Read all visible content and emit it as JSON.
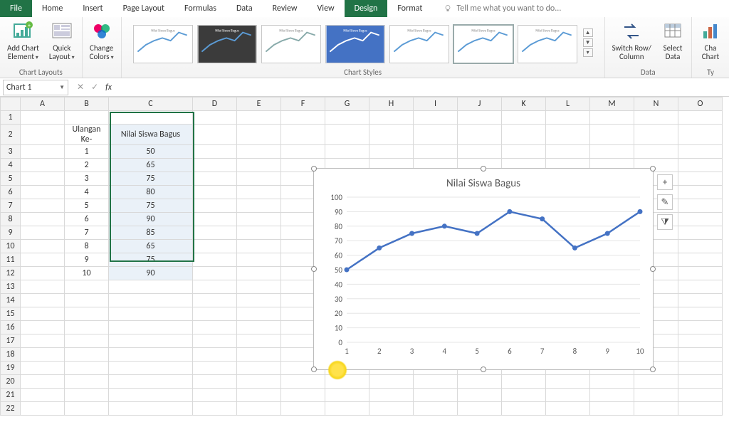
{
  "ribbon": {
    "tabs": [
      "File",
      "Home",
      "Insert",
      "Page Layout",
      "Formulas",
      "Data",
      "Review",
      "View",
      "Design",
      "Format"
    ],
    "active_tab": "Design",
    "tell_me": "Tell me what you want to do...",
    "groups": {
      "chart_layouts": {
        "label": "Chart Layouts",
        "add_chart_element": "Add Chart\nElement",
        "quick_layout": "Quick\nLayout"
      },
      "change_colors": "Change\nColors",
      "chart_styles": "Chart Styles",
      "data": {
        "label": "Data",
        "switch": "Switch Row/\nColumn",
        "select": "Select\nData"
      },
      "type": {
        "label": "Ty",
        "change": "Cha\nChart"
      }
    }
  },
  "name_box": "Chart 1",
  "formula_bar": "",
  "columns": [
    "A",
    "B",
    "C",
    "D",
    "E",
    "F",
    "G",
    "H",
    "I",
    "J",
    "K",
    "L",
    "M",
    "N",
    "O"
  ],
  "header_B": "Ulangan Ke-",
  "header_C": "Nilai Siswa Bagus",
  "rows": [
    {
      "n": 1,
      "v": 50
    },
    {
      "n": 2,
      "v": 65
    },
    {
      "n": 3,
      "v": 75
    },
    {
      "n": 4,
      "v": 80
    },
    {
      "n": 5,
      "v": 75
    },
    {
      "n": 6,
      "v": 90
    },
    {
      "n": 7,
      "v": 85
    },
    {
      "n": 8,
      "v": 65
    },
    {
      "n": 9,
      "v": 75
    },
    {
      "n": 10,
      "v": 90
    }
  ],
  "chart_data": {
    "type": "line",
    "title": "Nilai Siswa Bagus",
    "categories": [
      1,
      2,
      3,
      4,
      5,
      6,
      7,
      8,
      9,
      10
    ],
    "values": [
      50,
      65,
      75,
      80,
      75,
      90,
      85,
      65,
      75,
      90
    ],
    "xlabel": "",
    "ylabel": "",
    "ylim": [
      0,
      100
    ],
    "yticks": [
      0,
      10,
      20,
      30,
      40,
      50,
      60,
      70,
      80,
      90,
      100
    ],
    "series_color": "#4472c4"
  },
  "side_buttons": {
    "plus": "+",
    "brush": "✎",
    "filter": "⧩"
  }
}
